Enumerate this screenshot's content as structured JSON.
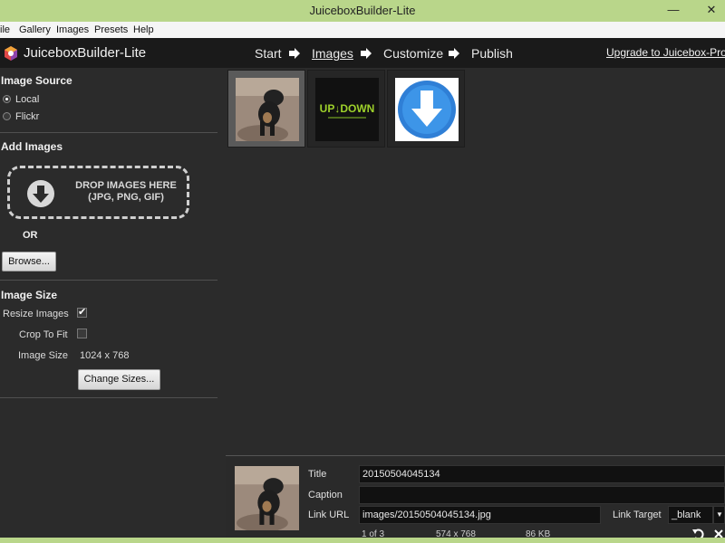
{
  "window": {
    "title": "JuiceboxBuilder-Lite",
    "minimize": "—",
    "close": "✕"
  },
  "menu": {
    "items": [
      "ile",
      "Gallery",
      "Images",
      "Presets",
      "Help"
    ]
  },
  "header": {
    "app_name": "JuiceboxBuilder-Lite",
    "steps": [
      "Start",
      "Images",
      "Customize",
      "Publish"
    ],
    "active_step": "Images",
    "upgrade": "Upgrade to Juicebox-Pro"
  },
  "image_source": {
    "title": "Image Source",
    "options": [
      {
        "label": "Local",
        "selected": true
      },
      {
        "label": "Flickr",
        "selected": false
      }
    ]
  },
  "add_images": {
    "title": "Add Images",
    "drop_text": "DROP IMAGES HERE",
    "drop_formats": "(JPG, PNG, GIF)",
    "or_label": "OR",
    "browse": "Browse..."
  },
  "image_size": {
    "title": "Image Size",
    "resize_label": "Resize Images",
    "resize_checked": true,
    "crop_label": "Crop To Fit",
    "crop_checked": false,
    "size_label": "Image Size",
    "size_value": "1024 x 768",
    "change_sizes": "Change Sizes..."
  },
  "thumbnails": [
    {
      "name": "dog photo",
      "selected": true
    },
    {
      "name": "UP DOWN",
      "selected": false
    },
    {
      "name": "download arrow",
      "selected": false
    }
  ],
  "details": {
    "title_label": "Title",
    "title_value": "20150504045134",
    "caption_label": "Caption",
    "caption_value": "",
    "link_url_label": "Link URL",
    "link_url_value": "images/20150504045134.jpg",
    "link_target_label": "Link Target",
    "link_target_value": "_blank",
    "index": "1 of 3",
    "dimensions": "574 x 768",
    "filesize": "86 KB"
  },
  "colors": {
    "accent": "#b9d68a",
    "panel": "#2b2b2b",
    "header": "#1a1a1a"
  }
}
